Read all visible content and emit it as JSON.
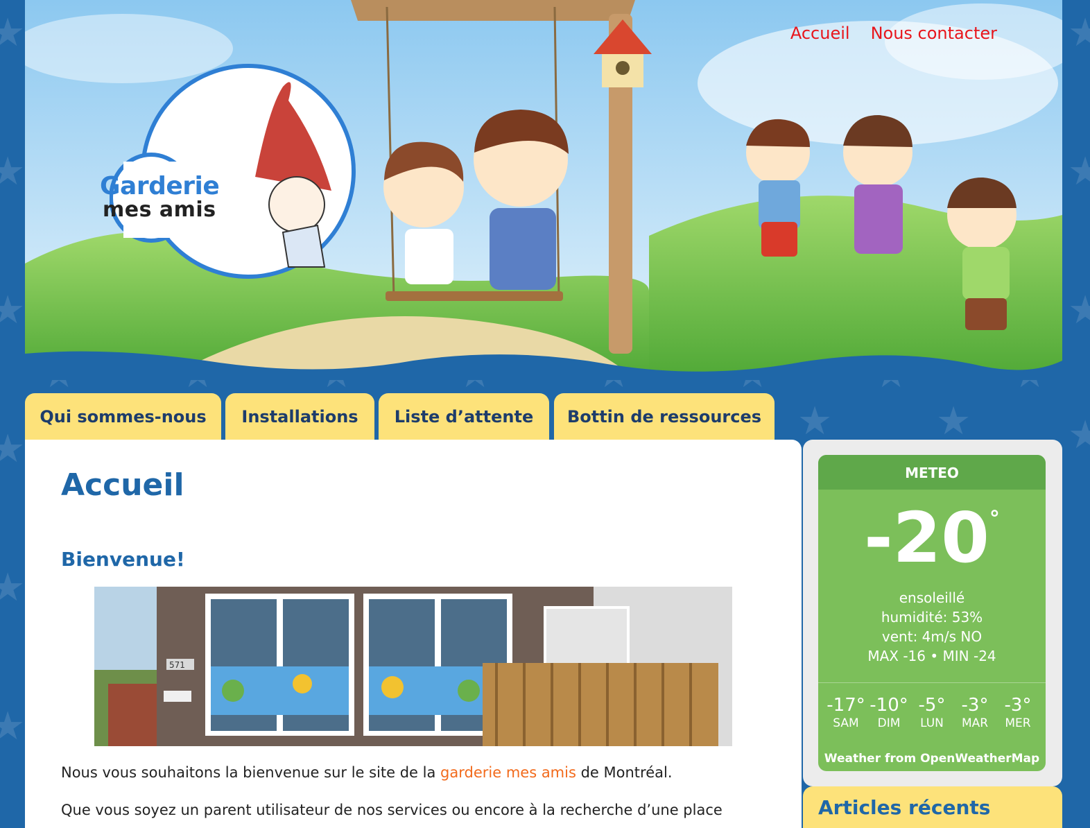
{
  "top_nav": [
    {
      "label": "Accueil"
    },
    {
      "label": "Nous contacter"
    }
  ],
  "logo": {
    "title": "Garderie",
    "subtitle": "mes amis"
  },
  "tabs": [
    {
      "label": "Qui sommes-nous"
    },
    {
      "label": "Installations"
    },
    {
      "label": "Liste d’attente"
    },
    {
      "label": "Bottin de ressources"
    }
  ],
  "main": {
    "page_title": "Accueil",
    "section_title": "Bienvenue!",
    "intro_before": "Nous vous souhaitons la bienvenue sur le site de la ",
    "intro_link": "garderie mes amis",
    "intro_after": " de Montréal.",
    "paragraph2": "Que vous soyez un parent utilisateur de nos services ou encore à la recherche d’une place",
    "house_number": "571"
  },
  "weather": {
    "header": "METEO",
    "temp": "-20",
    "degree": "°",
    "condition": "ensoleillé",
    "humidity": "humidité: 53%",
    "wind": "vent: 4m/s NO",
    "minmax": "MAX -16 • MIN -24",
    "forecast": [
      {
        "temp": "-17°",
        "day": "SAM"
      },
      {
        "temp": "-10°",
        "day": "DIM"
      },
      {
        "temp": "-5°",
        "day": "LUN"
      },
      {
        "temp": "-3°",
        "day": "MAR"
      },
      {
        "temp": "-3°",
        "day": "MER"
      }
    ],
    "credit": "Weather from OpenWeatherMap"
  },
  "articles": {
    "title": "Articles récents"
  },
  "colors": {
    "background": "#1f67a8",
    "nav_link": "#e8151b",
    "tab": "#fde27a",
    "heading": "#1f67a8",
    "link_orange": "#f26a1b",
    "weather_green": "#7cbf5a"
  }
}
